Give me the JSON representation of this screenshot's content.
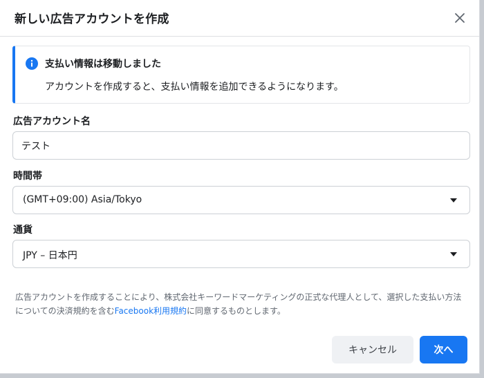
{
  "dialog": {
    "title": "新しい広告アカウントを作成",
    "close_icon": "close-icon"
  },
  "info": {
    "icon": "info-icon",
    "title": "支払い情報は移動しました",
    "text": "アカウントを作成すると、支払い情報を追加できるようになります。"
  },
  "fields": {
    "account_name": {
      "label": "広告アカウント名",
      "value": "テスト"
    },
    "timezone": {
      "label": "時間帯",
      "value": "(GMT+09:00) Asia/Tokyo"
    },
    "currency": {
      "label": "通貨",
      "value": "JPY – 日本円"
    }
  },
  "legal": {
    "before_link": "広告アカウントを作成することにより、株式会社キーワードマーケティングの正式な代理人として、選択した支払い方法についての決済規約を含む",
    "link": "Facebook利用規約",
    "after_link": "に同意するものとします。"
  },
  "buttons": {
    "cancel": "キャンセル",
    "next": "次へ"
  },
  "colors": {
    "accent": "#1877f2",
    "text": "#1c1e21",
    "muted": "#606770"
  }
}
